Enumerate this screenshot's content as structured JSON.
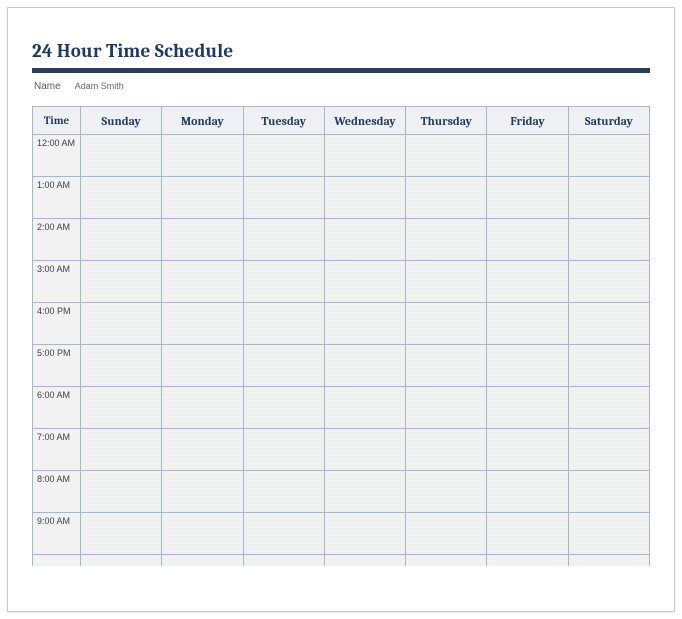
{
  "title": "24 Hour Time Schedule",
  "meta": {
    "name_label": "Name",
    "name_value": "Adam Smith"
  },
  "headers": {
    "time": "Time",
    "days": [
      "Sunday",
      "Monday",
      "Tuesday",
      "Wednesday",
      "Thursday",
      "Friday",
      "Saturday"
    ]
  },
  "times": [
    "12:00 AM",
    "1:00 AM",
    "2:00 AM",
    "3:00 AM",
    "4:00 PM",
    "5:00 PM",
    "6:00 AM",
    "7:00 AM",
    "8:00 AM",
    "9:00 AM"
  ]
}
